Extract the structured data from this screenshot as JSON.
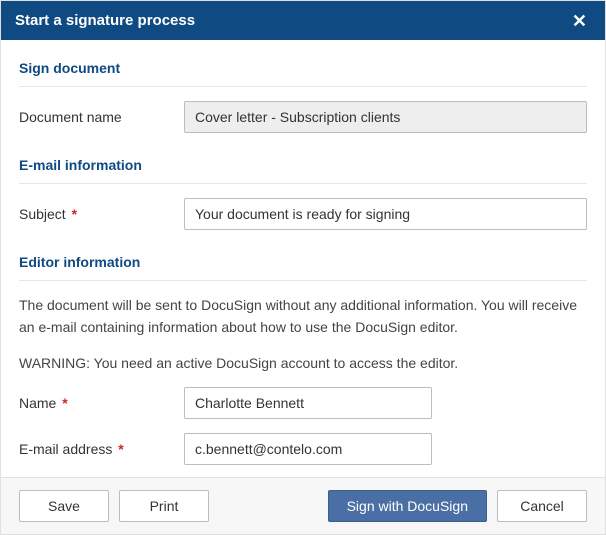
{
  "title": "Start a signature process",
  "sections": {
    "sign_doc": {
      "header": "Sign document",
      "doc_label": "Document name",
      "doc_value": "Cover letter - Subscription clients"
    },
    "email": {
      "header": "E-mail information",
      "subject_label": "Subject",
      "subject_value": "Your document is ready for signing"
    },
    "editor": {
      "header": "Editor information",
      "info_text": "The document will be sent to DocuSign without any additional information. You will receive an e-mail containing information about how to use the DocuSign editor.",
      "warning_text": "WARNING: You need an active DocuSign account to access the editor.",
      "name_label": "Name",
      "name_value": "Charlotte Bennett",
      "email_label": "E-mail address",
      "email_value": "c.bennett@contelo.com"
    }
  },
  "buttons": {
    "save": "Save",
    "print": "Print",
    "sign": "Sign with DocuSign",
    "cancel": "Cancel"
  },
  "required_marker": "*"
}
